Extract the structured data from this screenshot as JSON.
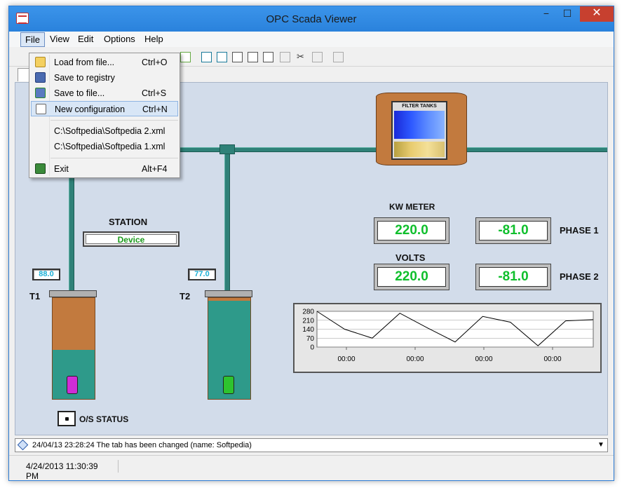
{
  "window": {
    "title": "OPC Scada Viewer",
    "min_glyph": "−",
    "max_glyph": "☐",
    "close_glyph": "✕"
  },
  "menubar": {
    "items": [
      "File",
      "View",
      "Edit",
      "Options",
      "Help"
    ]
  },
  "file_menu": {
    "items": [
      {
        "label": "Load from file...",
        "shortcut": "Ctrl+O",
        "icon": "folder-open-icon"
      },
      {
        "label": "Save to registry",
        "shortcut": "",
        "icon": "floppy-disk-icon"
      },
      {
        "label": "Save to file...",
        "shortcut": "Ctrl+S",
        "icon": "save-arrow-icon"
      },
      {
        "label": "New configuration",
        "shortcut": "Ctrl+N",
        "icon": "new-document-icon"
      }
    ],
    "recent": [
      "C:\\Softpedia\\Softpedia 2.xml",
      "C:\\Softpedia\\Softpedia 1.xml"
    ],
    "exit": {
      "label": "Exit",
      "shortcut": "Alt+F4",
      "icon": "exit-door-icon"
    }
  },
  "scada": {
    "station_label": "STATION",
    "station_value": "Device",
    "t1_label": "T1",
    "t1_value": "88.0",
    "t2_label": "T2",
    "t2_value": "77.0",
    "filter_label": "FILTER TANKS",
    "kw_meter_label": "KW METER",
    "volts_label": "VOLTS",
    "kw_value": "220.0",
    "kw_phase_value": "-81.0",
    "volts_value": "220.0",
    "volts_phase_value": "-81.0",
    "phase1_label": "PHASE 1",
    "phase2_label": "PHASE 2",
    "os_status_label": "O/S STATUS"
  },
  "chart_data": {
    "type": "line",
    "y_ticks": [
      "280",
      "210",
      "140",
      "70",
      "0"
    ],
    "ylim": [
      0,
      280
    ],
    "x_tick_labels": [
      "00:00",
      "00:00",
      "00:00",
      "00:00"
    ],
    "values": [
      280,
      140,
      70,
      265,
      150,
      40,
      240,
      195,
      10,
      205,
      215
    ],
    "grid": true
  },
  "log": {
    "text": "24/04/13 23:28:24 The tab has been changed (name: Softpedia)"
  },
  "status": {
    "datetime": "4/24/2013 11:30:39 PM"
  },
  "colors": {
    "titlebar": "#2b8ae6",
    "canvas": "#d2dcea",
    "pipe": "#2f8178",
    "meter_text": "#0fbf2c"
  }
}
